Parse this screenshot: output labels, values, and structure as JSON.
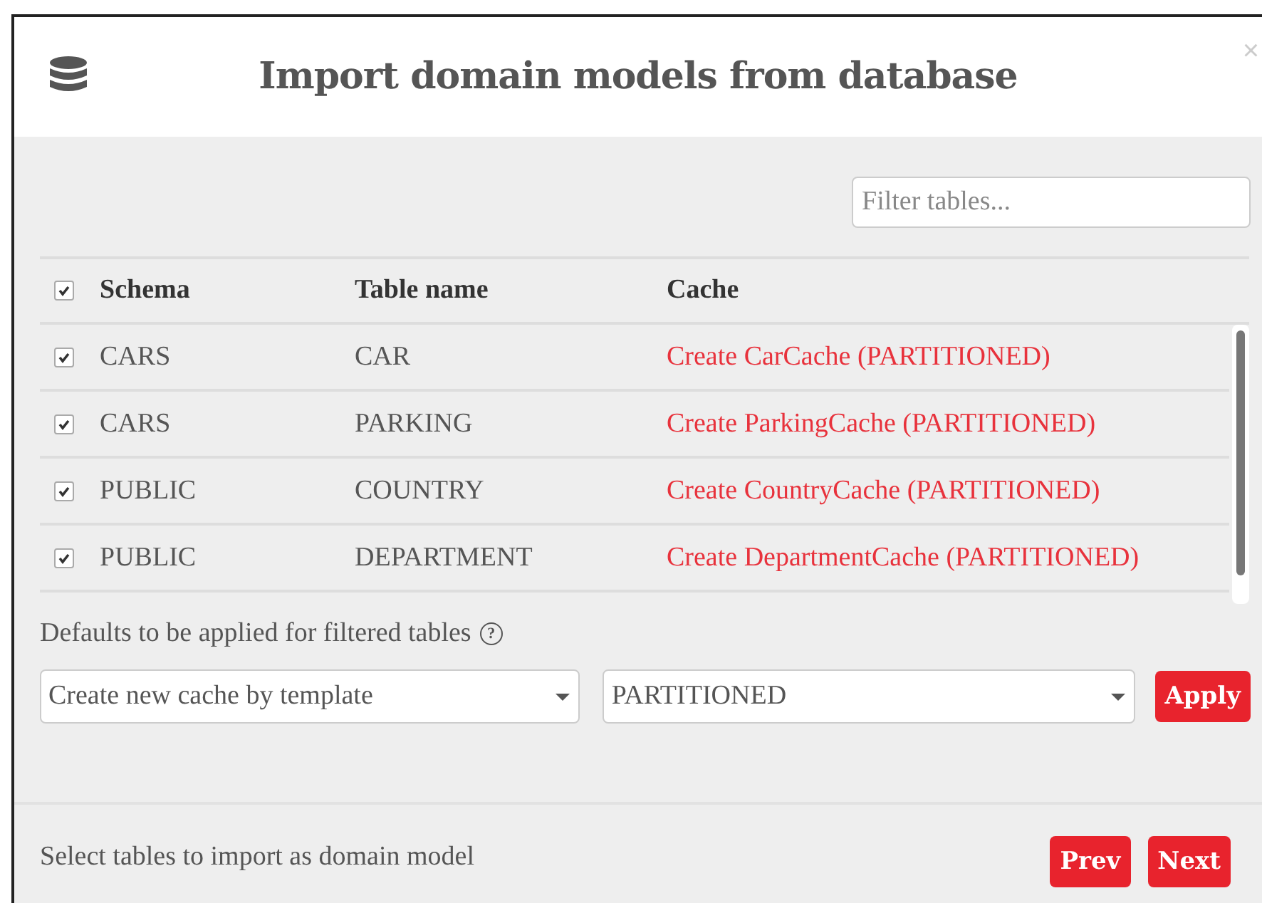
{
  "dialog": {
    "title": "Import domain models from database",
    "close": "×"
  },
  "filter": {
    "placeholder": "Filter tables..."
  },
  "table": {
    "all_checked": true,
    "columns": [
      "Schema",
      "Table name",
      "Cache"
    ],
    "rows": [
      {
        "checked": true,
        "schema": "CARS",
        "table": "CAR",
        "cache": "Create CarCache (PARTITIONED)"
      },
      {
        "checked": true,
        "schema": "CARS",
        "table": "PARKING",
        "cache": "Create ParkingCache (PARTITIONED)"
      },
      {
        "checked": true,
        "schema": "PUBLIC",
        "table": "COUNTRY",
        "cache": "Create CountryCache (PARTITIONED)"
      },
      {
        "checked": true,
        "schema": "PUBLIC",
        "table": "DEPARTMENT",
        "cache": "Create DepartmentCache (PARTITIONED)"
      }
    ]
  },
  "defaults": {
    "label": "Defaults to be applied for filtered tables",
    "help": "?",
    "action": "Create new cache by template",
    "template": "PARTITIONED",
    "apply": "Apply"
  },
  "footer": {
    "hint": "Select tables to import as domain model",
    "buttons": [
      "Prev",
      "Next"
    ]
  }
}
